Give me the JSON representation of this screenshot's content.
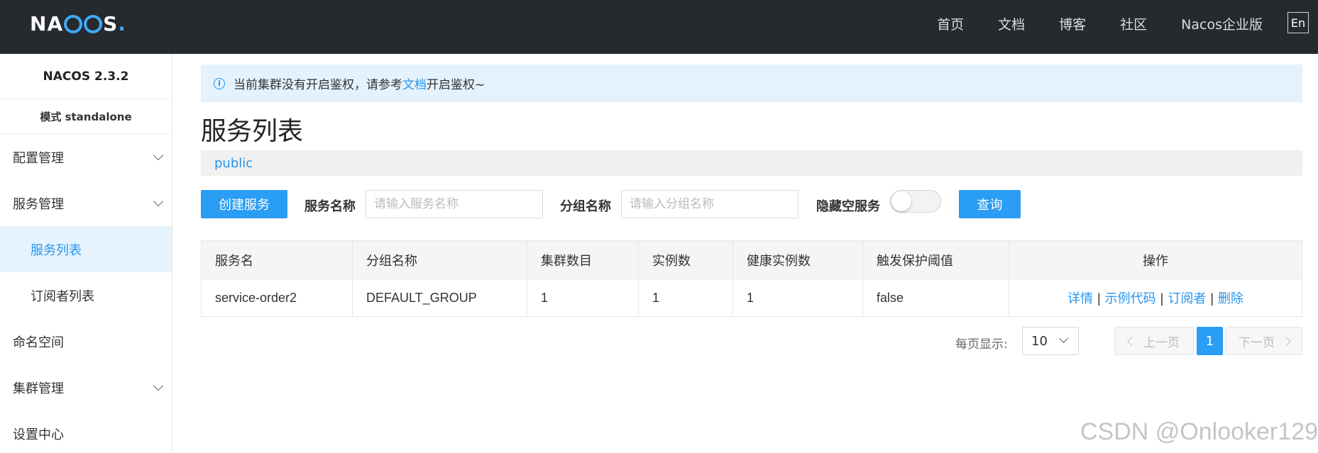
{
  "header": {
    "logo_text": "NACOS.",
    "nav": [
      "首页",
      "文档",
      "博客",
      "社区",
      "Nacos企业版"
    ],
    "lang_button": "En"
  },
  "sidebar": {
    "version": "NACOS 2.3.2",
    "mode": "模式 standalone",
    "items": [
      {
        "label": "配置管理",
        "expandable": true
      },
      {
        "label": "服务管理",
        "expandable": true
      },
      {
        "label": "服务列表",
        "sub": true,
        "active": true
      },
      {
        "label": "订阅者列表",
        "sub": true
      },
      {
        "label": "命名空间",
        "expandable": false
      },
      {
        "label": "集群管理",
        "expandable": true
      },
      {
        "label": "设置中心",
        "expandable": false
      }
    ]
  },
  "notice": {
    "text_before": "当前集群没有开启鉴权，请参考",
    "link": "文档",
    "text_after": "开启鉴权~"
  },
  "page_title": "服务列表",
  "namespace": "public",
  "filters": {
    "create_button": "创建服务",
    "service_name_label": "服务名称",
    "service_name_placeholder": "请输入服务名称",
    "group_name_label": "分组名称",
    "group_name_placeholder": "请输入分组名称",
    "hide_empty_label": "隐藏空服务",
    "hide_empty_enabled": false,
    "query_button": "查询"
  },
  "table": {
    "columns": [
      "服务名",
      "分组名称",
      "集群数目",
      "实例数",
      "健康实例数",
      "触发保护阈值",
      "操作"
    ],
    "rows": [
      {
        "service": "service-order2",
        "group": "DEFAULT_GROUP",
        "clusters": "1",
        "instances": "1",
        "healthy": "1",
        "threshold": "false",
        "actions": [
          "详情",
          "示例代码",
          "订阅者",
          "删除"
        ]
      }
    ]
  },
  "pagination": {
    "page_size_label": "每页显示:",
    "page_size": "10",
    "prev": "上一页",
    "current": "1",
    "next": "下一页"
  },
  "watermark": "CSDN @Onlooker129",
  "colors": {
    "topbar": "#252a2f",
    "accent": "#2a9df4",
    "link": "#2895ee",
    "notice_bg": "#e3f2fc"
  }
}
